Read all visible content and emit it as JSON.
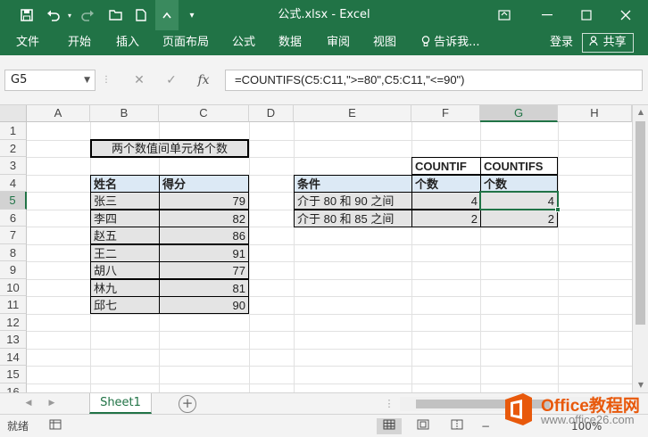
{
  "title_bar": {
    "title": "公式.xlsx - Excel",
    "icons": [
      "save-icon",
      "undo-icon",
      "redo-icon",
      "open-icon",
      "new-icon",
      "touch-mode-icon",
      "customize-icon"
    ]
  },
  "window_controls": [
    "ribbon-display-icon",
    "minimize-icon",
    "maximize-icon",
    "close-icon"
  ],
  "menu": {
    "items": [
      "文件",
      "开始",
      "插入",
      "页面布局",
      "公式",
      "数据",
      "审阅",
      "视图"
    ],
    "tell_me": "告诉我...",
    "login": "登录",
    "share": "共享"
  },
  "formula_bar": {
    "name_box": "G5",
    "fx": "fx",
    "formula": "=COUNTIFS(C5:C11,\">=80\",C5:C11,\"<=90\")"
  },
  "columns": [
    "A",
    "B",
    "C",
    "D",
    "E",
    "F",
    "G",
    "H"
  ],
  "rows": [
    "1",
    "2",
    "3",
    "4",
    "5",
    "6",
    "7",
    "8",
    "9",
    "10",
    "11",
    "12",
    "13",
    "14",
    "15",
    "16"
  ],
  "selected_cell": {
    "col": "G",
    "row": "5"
  },
  "sheet": {
    "title_cell": "两个数值间单元格个数",
    "table_headers": [
      "姓名",
      "得分"
    ],
    "table_rows": [
      {
        "name": "张三",
        "score": "79"
      },
      {
        "name": "李四",
        "score": "82"
      },
      {
        "name": "赵五",
        "score": "86"
      },
      {
        "name": "王二",
        "score": "91"
      },
      {
        "name": "胡八",
        "score": "77"
      },
      {
        "name": "林九",
        "score": "81"
      },
      {
        "name": "邱七",
        "score": "90"
      }
    ],
    "result_top_headers": [
      "COUNTIF",
      "COUNTIFS"
    ],
    "result_headers": [
      "条件",
      "个数",
      "个数"
    ],
    "result_rows": [
      {
        "condition": "介于 80 和 90 之间",
        "countif": "4",
        "countifs": "4"
      },
      {
        "condition": "介于 80 和 85 之间",
        "countif": "2",
        "countifs": "2"
      }
    ]
  },
  "tabs": {
    "active": "Sheet1",
    "add_label": "+"
  },
  "status": {
    "text": "就绪",
    "zoom": "100%"
  },
  "watermark": {
    "title": "Office教程网",
    "url": "www.office26.com"
  }
}
